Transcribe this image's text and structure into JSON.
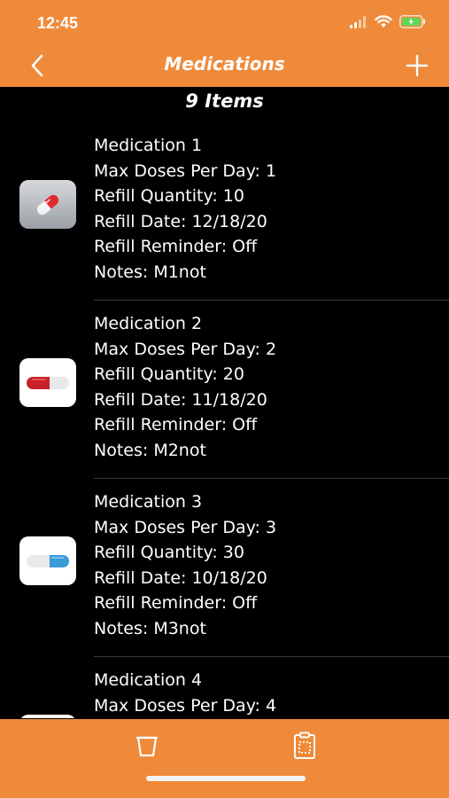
{
  "status": {
    "time": "12:45"
  },
  "nav": {
    "title": "Medications"
  },
  "count_label": "9 Items",
  "medications": [
    {
      "name": "Medication 1",
      "max_doses": "Max Doses Per Day: 1",
      "refill_quantity": "Refill Quantity: 10",
      "refill_date": "Refill Date: 12/18/20",
      "refill_reminder": "Refill Reminder: Off",
      "notes": "Notes: M1not",
      "icon": "capsule-red-white-icon"
    },
    {
      "name": "Medication 2",
      "max_doses": "Max Doses Per Day: 2",
      "refill_quantity": "Refill Quantity: 20",
      "refill_date": "Refill Date: 11/18/20",
      "refill_reminder": "Refill Reminder: Off",
      "notes": "Notes: M2not",
      "icon": "capsule-red-white-icon"
    },
    {
      "name": "Medication 3",
      "max_doses": "Max Doses Per Day: 3",
      "refill_quantity": "Refill Quantity: 30",
      "refill_date": "Refill Date: 10/18/20",
      "refill_reminder": "Refill Reminder: Off",
      "notes": "Notes: M3not",
      "icon": "capsule-blue-white-icon"
    },
    {
      "name": "Medication 4",
      "max_doses": "Max Doses Per Day: 4",
      "icon": "pill-red-icon"
    }
  ],
  "toolbar": {
    "delete_icon": "trash-icon",
    "clipboard_icon": "clipboard-icon"
  },
  "colors": {
    "accent": "#ef8a3a",
    "background": "#000000",
    "text": "#ffffff",
    "divider": "#3a3a3a"
  }
}
